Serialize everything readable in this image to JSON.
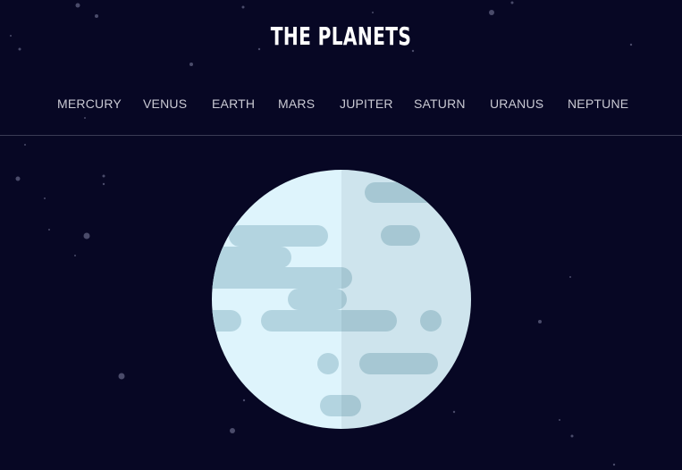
{
  "header": {
    "title": "THE PLANETS"
  },
  "nav": {
    "items": [
      {
        "label": "MERCURY"
      },
      {
        "label": "VENUS"
      },
      {
        "label": "EARTH"
      },
      {
        "label": "MARS"
      },
      {
        "label": "JUPITER"
      },
      {
        "label": "SATURN"
      },
      {
        "label": "URANUS"
      },
      {
        "label": "NEPTUNE"
      }
    ]
  },
  "planet": {
    "icon": "planet-uranus-icon"
  },
  "colors": {
    "background": "#070724",
    "title": "#ffffff",
    "nav_text": "#c9c9d3",
    "divider": "#3a3b55",
    "planet_light": "#def4fc",
    "planet_shade": "#cee3eb",
    "planet_bands": "#b3d4e0"
  }
}
